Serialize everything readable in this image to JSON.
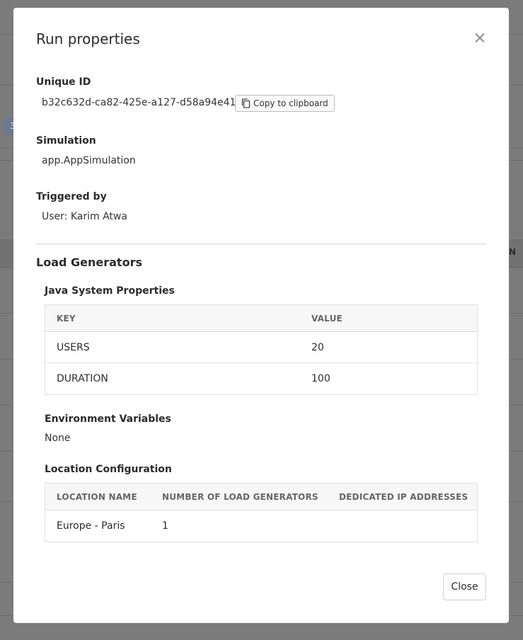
{
  "modal": {
    "title": "Run properties",
    "unique_id_label": "Unique ID",
    "unique_id": "b32c632d-ca82-425e-a127-d58a94e411cd",
    "copy_label": "Copy to clipboard",
    "simulation_label": "Simulation",
    "simulation": "app.AppSimulation",
    "triggered_by_label": "Triggered by",
    "triggered_by": "User: Karim Atwa",
    "load_generators_title": "Load Generators",
    "java_props_label": "Java System Properties",
    "java_props": {
      "columns": [
        "KEY",
        "VALUE"
      ],
      "rows": [
        [
          "USERS",
          "20"
        ],
        [
          "DURATION",
          "100"
        ]
      ]
    },
    "env_vars_label": "Environment Variables",
    "env_vars_value": "None",
    "location_label": "Location Configuration",
    "location": {
      "columns": [
        "LOCATION NAME",
        "NUMBER OF LOAD GENERATORS",
        "DEDICATED IP ADDRESSES"
      ],
      "rows": [
        [
          "Europe - Paris",
          "1",
          ""
        ]
      ]
    },
    "close_button": "Close"
  },
  "background": {
    "avatar_initial": "3",
    "edge_text": "N"
  },
  "icons": {
    "close": "close-icon",
    "copy": "copy-icon"
  }
}
